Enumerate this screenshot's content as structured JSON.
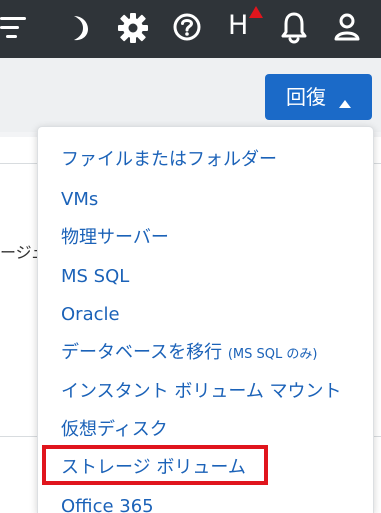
{
  "header": {
    "icons": [
      "filter-icon",
      "moon-icon",
      "gear-icon",
      "help-icon",
      "health-icon",
      "bell-icon",
      "user-icon"
    ],
    "health_letter": "H",
    "alert_color": "#e0151d"
  },
  "toolbar": {
    "recovery_button_label": "回復"
  },
  "content": {
    "clipped_text": "ージュ"
  },
  "dropdown": {
    "items": [
      {
        "label": "ファイルまたはフォルダー"
      },
      {
        "label": "VMs"
      },
      {
        "label": "物理サーバー"
      },
      {
        "label": "MS SQL"
      },
      {
        "label": "Oracle"
      },
      {
        "label": "データベースを移行",
        "suffix": "(MS SQL のみ)"
      },
      {
        "label": "インスタント ボリューム マウント"
      },
      {
        "label": "仮想ディスク"
      },
      {
        "label": "ストレージ ボリューム"
      },
      {
        "label": "Office 365"
      }
    ]
  },
  "colors": {
    "header_bg": "#2f3439",
    "accent": "#1b6ac8",
    "menu_text": "#1b62b8",
    "highlight": "#e0151d"
  }
}
